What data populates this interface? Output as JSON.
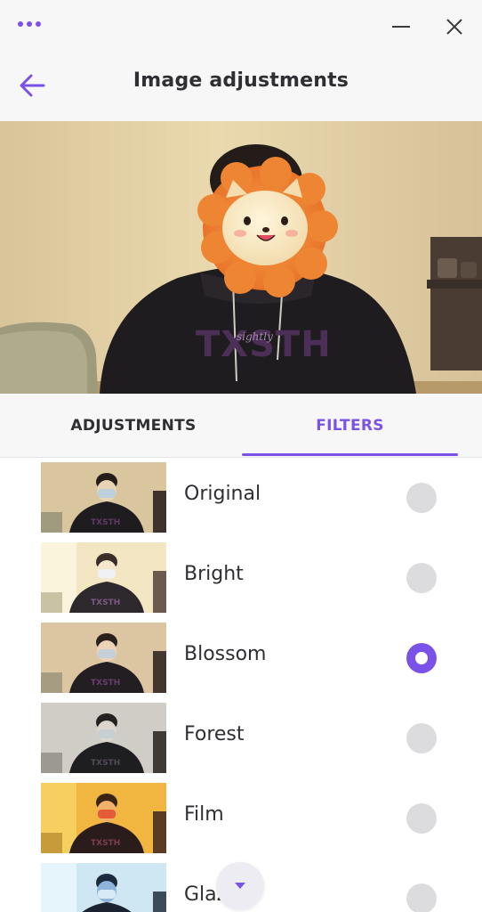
{
  "titlebar": {
    "more_icon": "more-dots-icon",
    "minimize_icon": "minimize-icon",
    "close_icon": "close-icon"
  },
  "header": {
    "title": "Image adjustments",
    "back_icon": "arrow-left-icon"
  },
  "preview": {
    "shirt_text": "TXSTH",
    "shirt_subtext": "sightly"
  },
  "tabs": [
    {
      "label": "ADJUSTMENTS",
      "active": false
    },
    {
      "label": "FILTERS",
      "active": true
    }
  ],
  "filters": [
    {
      "name": "Original",
      "selected": false
    },
    {
      "name": "Bright",
      "selected": false
    },
    {
      "name": "Blossom",
      "selected": true
    },
    {
      "name": "Forest",
      "selected": false
    },
    {
      "name": "Film",
      "selected": false
    },
    {
      "name": "Glaze",
      "selected": false
    }
  ],
  "scroll_button": {
    "icon": "chevron-down-icon"
  },
  "colors": {
    "accent": "#7b52e8",
    "background": "#f7f7f8",
    "radio_inactive": "#dcdcdf",
    "text": "#2f2f33"
  }
}
